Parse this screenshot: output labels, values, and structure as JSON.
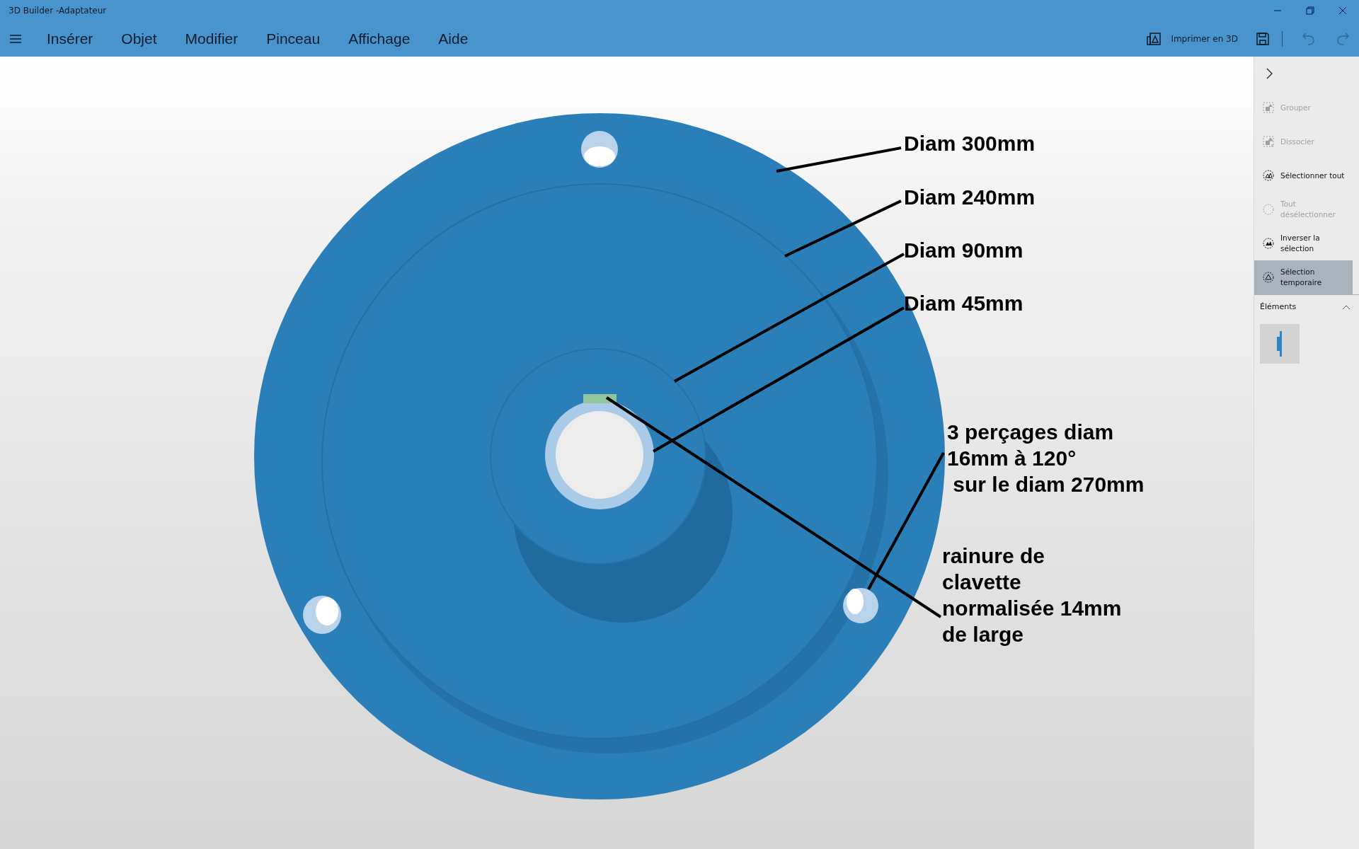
{
  "window": {
    "title": "3D Builder -Adaptateur"
  },
  "menu": {
    "items": [
      "Insérer",
      "Objet",
      "Modifier",
      "Pinceau",
      "Affichage",
      "Aide"
    ]
  },
  "toolbar": {
    "print_label": "Imprimer en 3D",
    "undo": {
      "disabled": true
    },
    "redo": {
      "disabled": true
    }
  },
  "side_panel": {
    "items": [
      {
        "kind": "group",
        "label": "Grouper",
        "disabled": true,
        "selected": false
      },
      {
        "kind": "ungroup",
        "label": "Dissocier",
        "disabled": true,
        "selected": false
      },
      {
        "kind": "select-all",
        "label": "Sélectionner tout",
        "disabled": false,
        "selected": false
      },
      {
        "kind": "deselect",
        "label": "Tout désélectionner",
        "disabled": true,
        "selected": false
      },
      {
        "kind": "invert",
        "label": "Inverser la sélection",
        "disabled": false,
        "selected": false
      },
      {
        "kind": "temporary",
        "label": "Sélection temporaire",
        "disabled": false,
        "selected": true
      }
    ],
    "elements": {
      "heading": "Éléments",
      "expanded": true
    }
  },
  "viewport": {
    "annotations": [
      {
        "text": "Diam 300mm"
      },
      {
        "text": "Diam 240mm"
      },
      {
        "text": "Diam 90mm"
      },
      {
        "text": "Diam 45mm"
      },
      {
        "text": "3 perçages diam\n16mm à 120°\n sur le diam 270mm"
      },
      {
        "text": "rainure de\nclavette\nnormalisée 14mm\nde large"
      }
    ]
  }
}
